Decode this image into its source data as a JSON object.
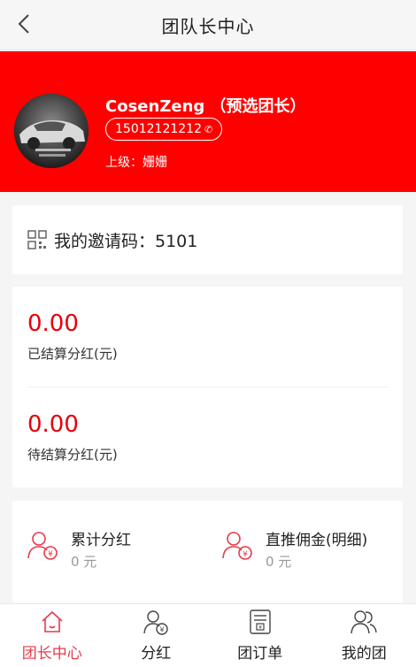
{
  "nav": {
    "title": "团队长中心",
    "back_icon": "chevron-left-icon"
  },
  "profile": {
    "name": "CosenZeng （预选团长）",
    "phone": "15012121212",
    "phone_icon": "phone-icon",
    "superior": "上级：姗姗"
  },
  "invite": {
    "text": "我的邀请码：5101",
    "icon": "qr-code-icon"
  },
  "stats": [
    {
      "amount": "0.00",
      "label": "已结算分红(元)"
    },
    {
      "amount": "0.00",
      "label": "待结算分红(元)"
    }
  ],
  "bonus": [
    {
      "title": "累计分红",
      "value": "0 元",
      "icon": "user-yuan-icon"
    },
    {
      "title": "直推佣金(明细)",
      "value": "0 元",
      "icon": "user-yuan-icon"
    }
  ],
  "tabs": [
    {
      "label": "团长中心",
      "icon": "home-icon",
      "active": true
    },
    {
      "label": "分红",
      "icon": "user-yuan-icon",
      "active": false
    },
    {
      "label": "团订单",
      "icon": "order-list-icon",
      "active": false
    },
    {
      "label": "我的团",
      "icon": "team-icon",
      "active": false
    }
  ],
  "colors": {
    "brand_red": "#ff0000",
    "accent_red": "#e8000b",
    "tab_active": "#e8394a"
  }
}
